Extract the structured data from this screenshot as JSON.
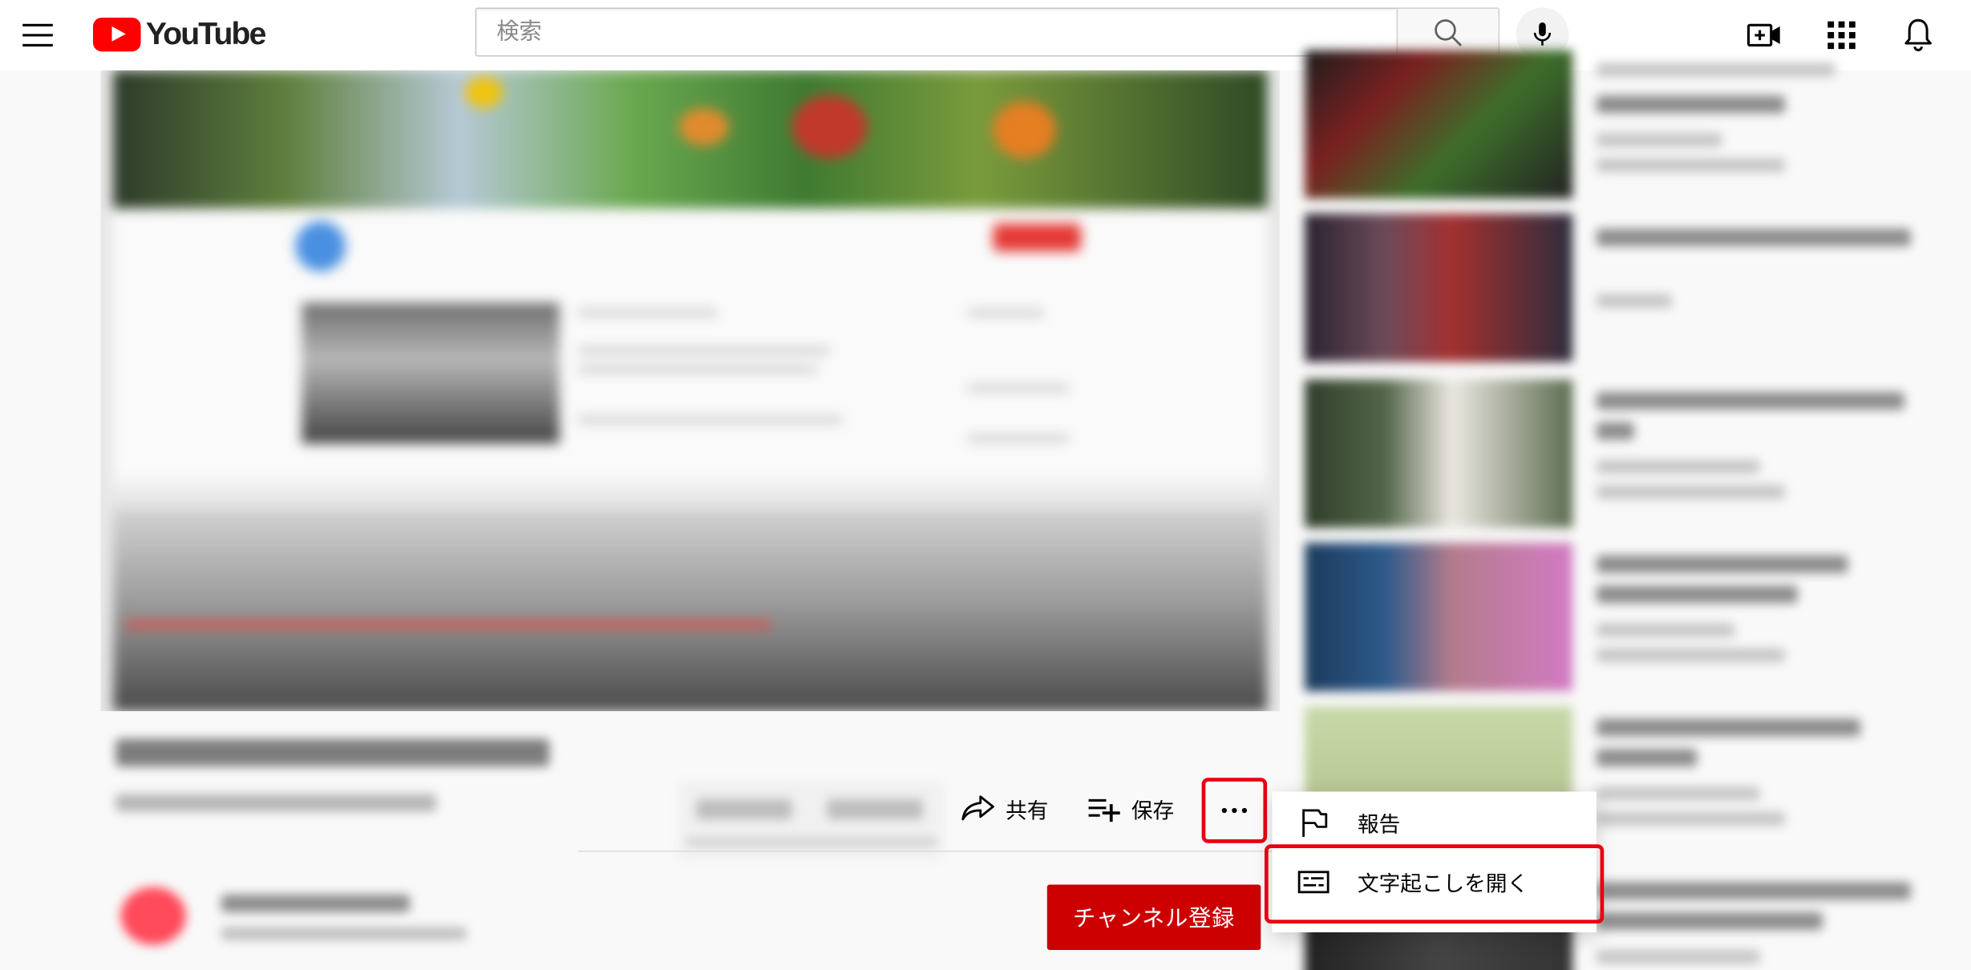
{
  "header": {
    "logo_text": "YouTube",
    "search_placeholder": "検索"
  },
  "actions": {
    "share_label": "共有",
    "save_label": "保存"
  },
  "channel": {
    "subscribe_label": "チャンネル登録"
  },
  "menu": {
    "items": [
      {
        "label": "報告",
        "icon": "flag-icon"
      },
      {
        "label": "文字起こしを開く",
        "icon": "transcript-icon"
      }
    ]
  },
  "colors": {
    "brand_red": "#ff0000",
    "subscribe_red": "#cc0000",
    "highlight_red": "#e60012"
  }
}
